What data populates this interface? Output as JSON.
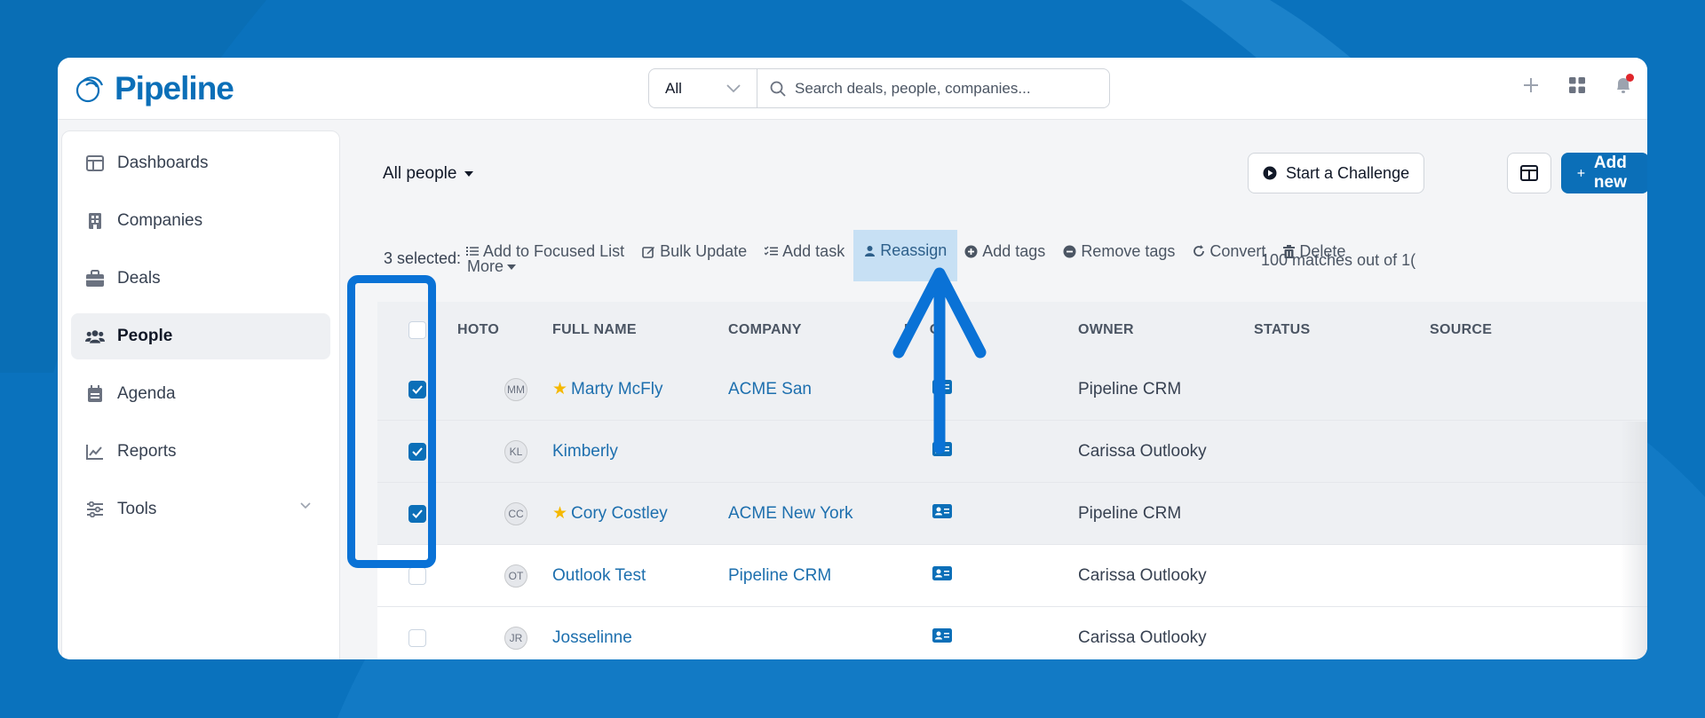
{
  "brand": {
    "name": "Pipeline",
    "color": "#0b6fb8"
  },
  "search": {
    "scope": "All",
    "placeholder": "Search deals, people, companies..."
  },
  "sidebar": {
    "items": [
      {
        "label": "Dashboards",
        "icon": "dashboard-icon",
        "active": false
      },
      {
        "label": "Companies",
        "icon": "building-icon",
        "active": false
      },
      {
        "label": "Deals",
        "icon": "briefcase-icon",
        "active": false
      },
      {
        "label": "People",
        "icon": "people-icon",
        "active": true
      },
      {
        "label": "Agenda",
        "icon": "calendar-icon",
        "active": false
      },
      {
        "label": "Reports",
        "icon": "chart-line-icon",
        "active": false
      },
      {
        "label": "Tools",
        "icon": "sliders-icon",
        "active": false
      }
    ]
  },
  "view": {
    "label": "All people"
  },
  "buttons": {
    "challenge": "Start a Challenge",
    "add_new": "Add new"
  },
  "bulk": {
    "selected": "3 selected:",
    "actions": [
      {
        "label": "Add to Focused List",
        "icon": "list-icon"
      },
      {
        "label": "Bulk Update",
        "icon": "edit-icon"
      },
      {
        "label": "Add task",
        "icon": "task-list-icon"
      },
      {
        "label": "Reassign",
        "icon": "user-icon",
        "highlighted": true
      },
      {
        "label": "Add tags",
        "icon": "plus-circle-icon"
      },
      {
        "label": "Remove tags",
        "icon": "minus-circle-icon"
      },
      {
        "label": "Convert",
        "icon": "refresh-icon"
      },
      {
        "label": "Delete",
        "icon": "trash-icon"
      }
    ],
    "more": "More",
    "matches": "100 matches out of 1("
  },
  "table": {
    "columns": [
      "HOTO",
      "FULL NAME",
      "COMPANY",
      "I",
      "O",
      "OWNER",
      "STATUS",
      "SOURCE"
    ],
    "rows": [
      {
        "initials": "MM",
        "name": "Marty McFly",
        "starred": true,
        "company": "ACME San",
        "owner": "Pipeline CRM",
        "checked": true
      },
      {
        "initials": "KL",
        "name": "Kimberly",
        "starred": false,
        "company": "",
        "owner": "Carissa Outlooky",
        "checked": true
      },
      {
        "initials": "CC",
        "name": "Cory Costley",
        "starred": true,
        "company": "ACME New York",
        "owner": "Pipeline CRM",
        "checked": true
      },
      {
        "initials": "OT",
        "name": "Outlook Test",
        "starred": false,
        "company": "Pipeline CRM",
        "owner": "Carissa Outlooky",
        "checked": false
      },
      {
        "initials": "JR",
        "name": "Josselinne",
        "starred": false,
        "company": "",
        "owner": "Carissa Outlooky",
        "checked": false
      }
    ]
  },
  "colors": {
    "background": "#0a72bd",
    "accent": "#0b6fb8",
    "annotation": "#0a72d6",
    "notification": "#e0262b",
    "star": "#f5b800"
  }
}
